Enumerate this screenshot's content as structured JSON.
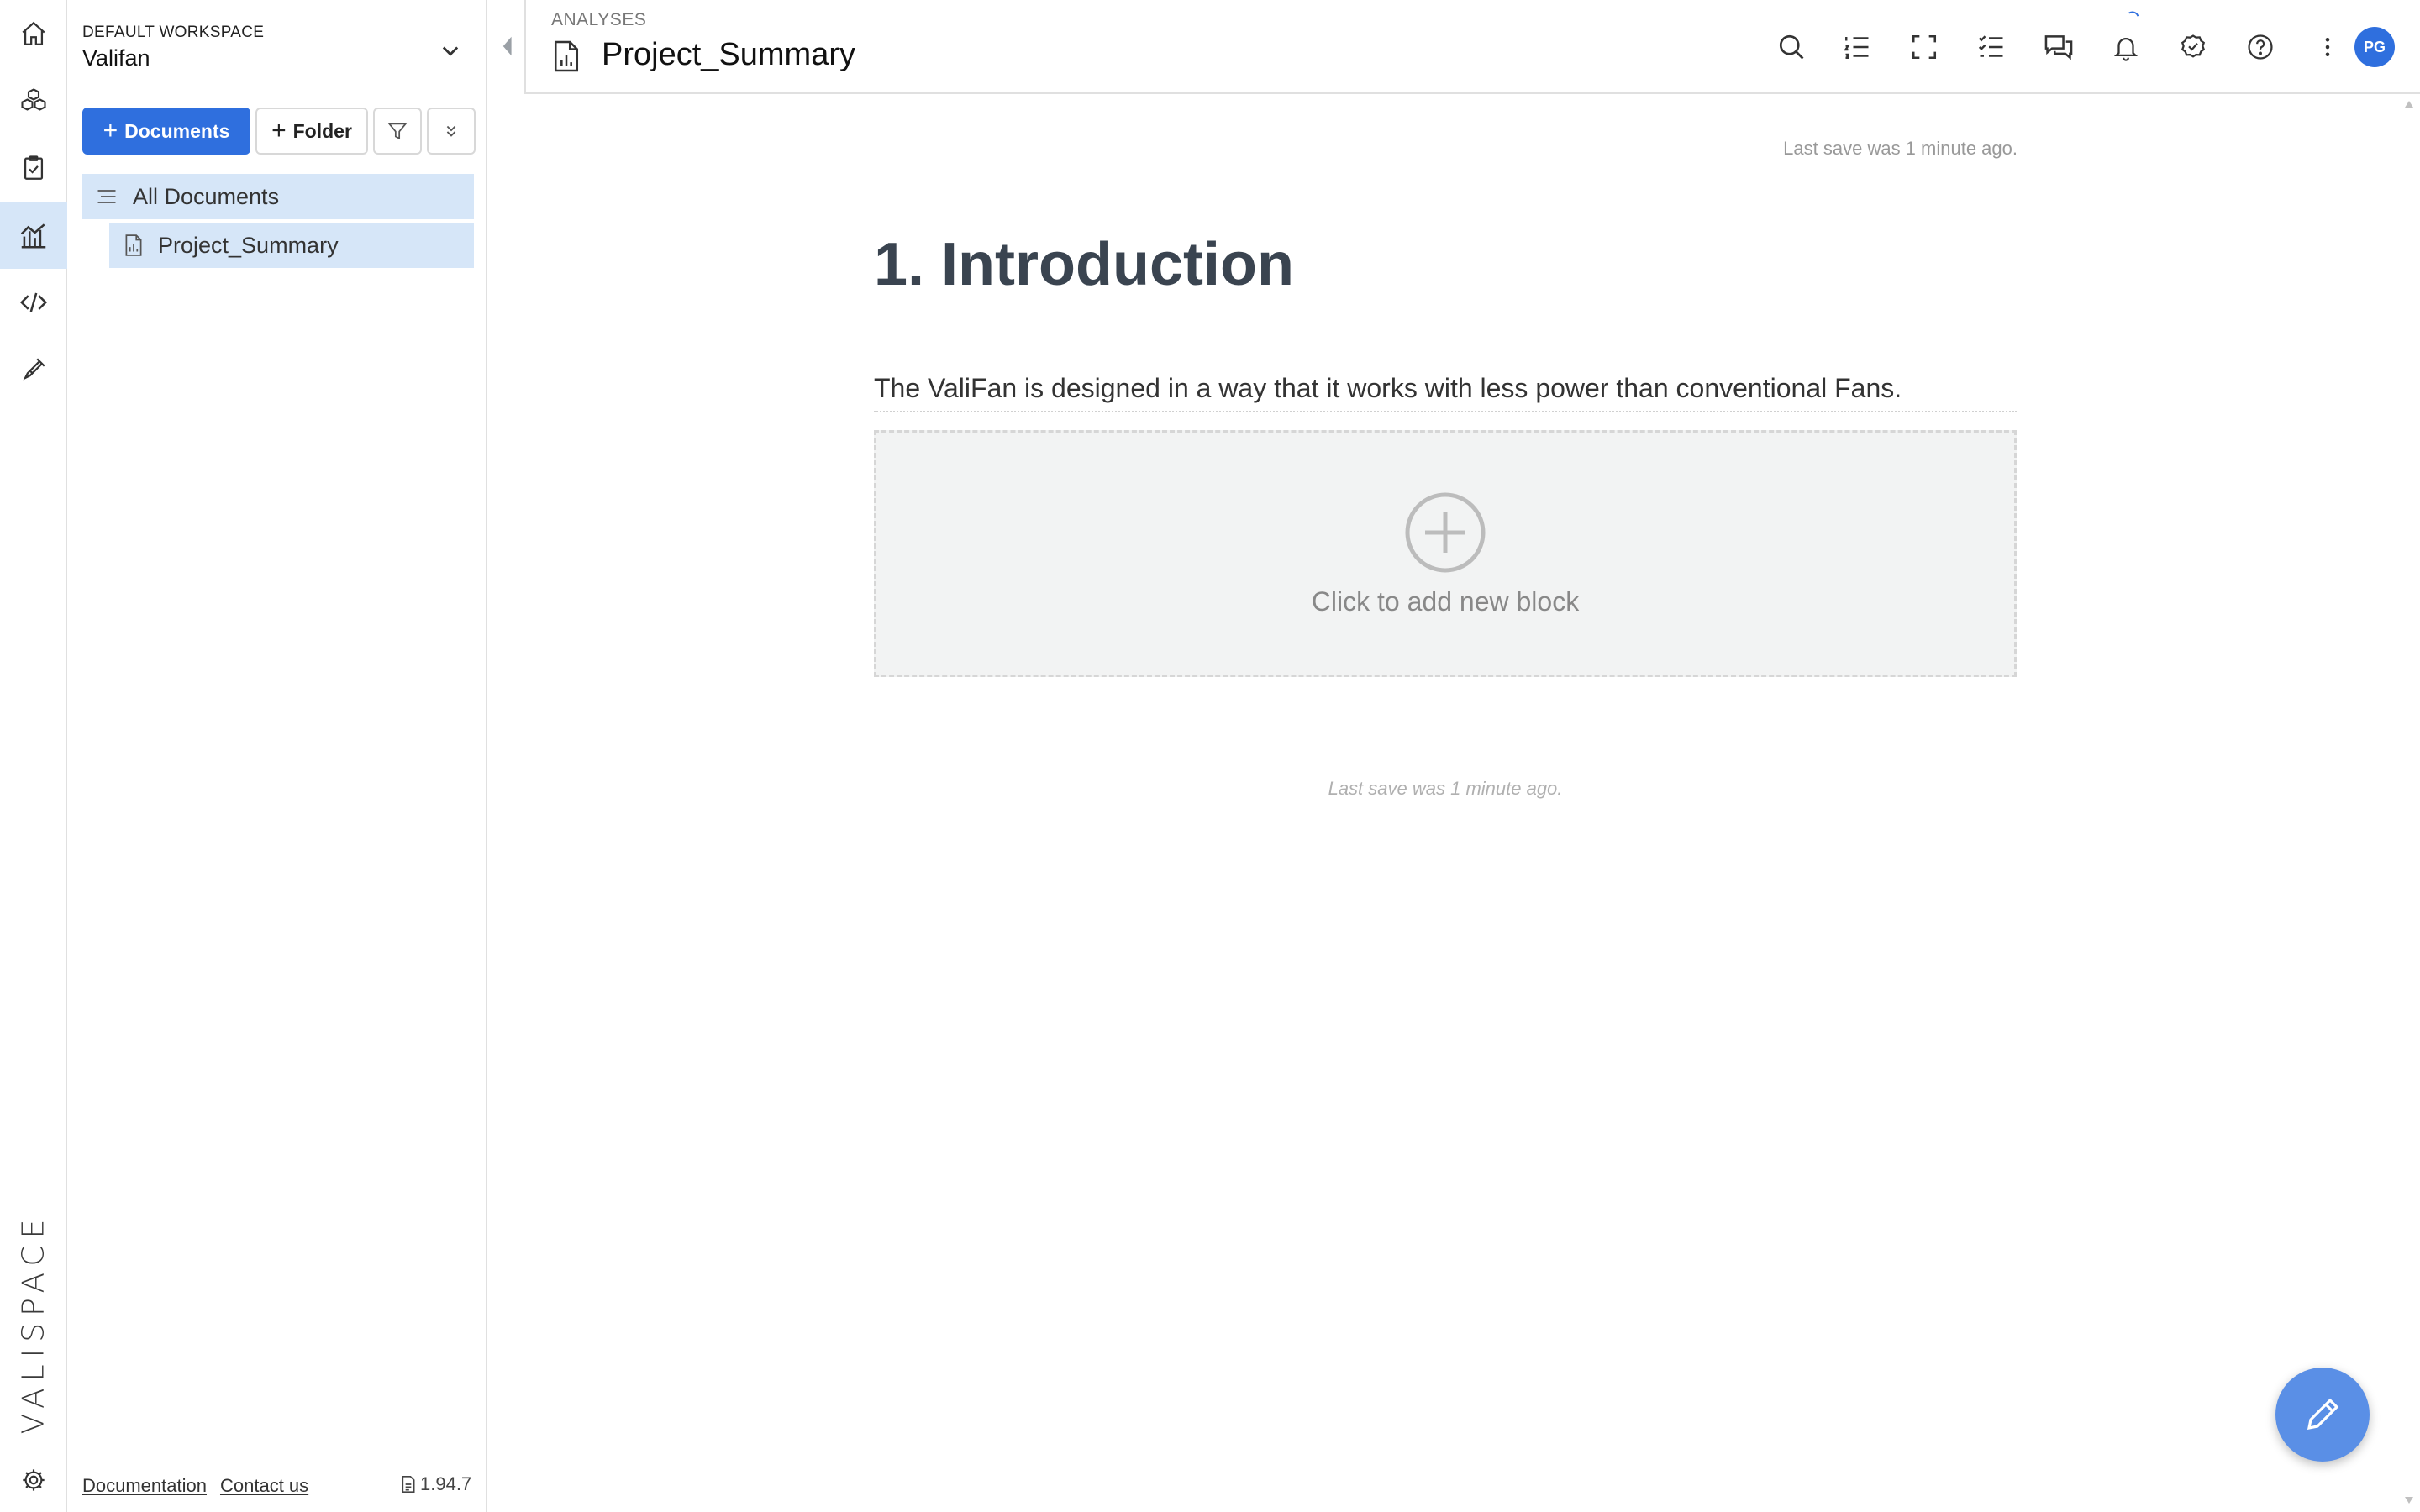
{
  "app": {
    "logo_text": "VALISPACE",
    "version": "1.94.7",
    "footer_links": [
      "Documentation",
      "Contact us"
    ]
  },
  "rail": {
    "items": [
      "home-icon",
      "components-icon",
      "requirements-icon",
      "analyses-icon",
      "scripting-icon",
      "tests-icon"
    ],
    "active": "analyses-icon",
    "settings": "settings-icon"
  },
  "workspace": {
    "label": "DEFAULT WORKSPACE",
    "name": "Valifan"
  },
  "navigator": {
    "add_documents_label": "Documents",
    "add_folder_label": "Folder",
    "tree": {
      "all_documents": "All Documents",
      "selected_document": "Project_Summary"
    }
  },
  "header": {
    "breadcrumb": "ANALYSES",
    "title": "Project_Summary",
    "avatar_initials": "PG",
    "icons": [
      "search-icon",
      "outline-icon",
      "fullscreen-icon",
      "checklist-icon",
      "comments-icon",
      "notifications-icon",
      "review-icon",
      "help-icon",
      "more-icon"
    ]
  },
  "document": {
    "last_save_top": "Last save was 1 minute ago.",
    "heading": "1. Introduction",
    "paragraph": "The ValiFan is designed in a way that it works with less power than conventional Fans.",
    "add_block_label": "Click to add new block",
    "last_save_bottom": "Last save was 1 minute ago."
  },
  "colors": {
    "accent": "#2f6fde",
    "selection": "#d6e6f8",
    "fab": "#5a8fe6",
    "heading": "#3a4450"
  }
}
